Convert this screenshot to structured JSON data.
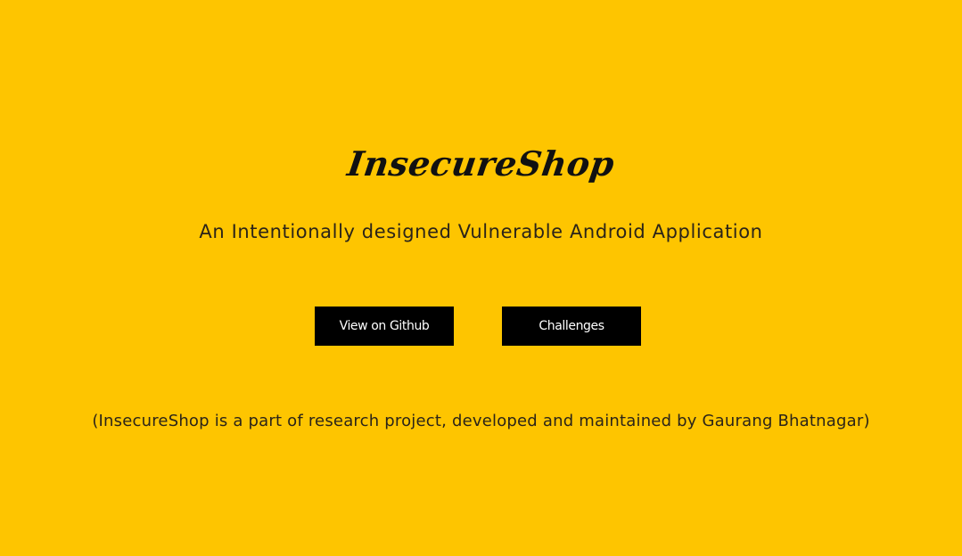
{
  "hero": {
    "title": "InsecureShop",
    "tagline": "An Intentionally designed Vulnerable Android Application"
  },
  "actions": {
    "github_label": "View on Github",
    "challenges_label": "Challenges"
  },
  "footer": {
    "note": "(InsecureShop is a part of research project, developed and maintained by Gaurang Bhatnagar)"
  },
  "colors": {
    "background": "#FEC500",
    "button_background": "#000000",
    "button_text": "#FFFFFF",
    "text": "#2B2419"
  }
}
